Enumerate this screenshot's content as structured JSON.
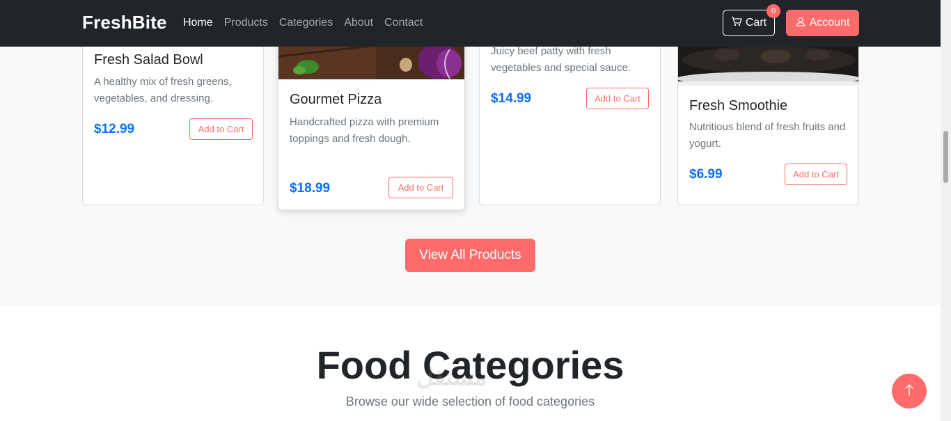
{
  "navbar": {
    "brand": "FreshBite",
    "links": [
      "Home",
      "Products",
      "Categories",
      "About",
      "Contact"
    ],
    "active_link": "Home",
    "cart_label": "Cart",
    "cart_count": "0",
    "account_label": "Account"
  },
  "products": [
    {
      "title": "Fresh Salad Bowl",
      "desc": "A healthy mix of fresh greens, vegetables, and dressing.",
      "price": "$12.99",
      "button": "Add to Cart"
    },
    {
      "title": "Gourmet Pizza",
      "desc": "Handcrafted pizza with premium toppings and fresh dough.",
      "price": "$18.99",
      "button": "Add to Cart"
    },
    {
      "title": "",
      "desc": "Juicy beef patty with fresh vegetables and special sauce.",
      "price": "$14.99",
      "button": "Add to Cart"
    },
    {
      "title": "Fresh Smoothie",
      "desc": "Nutritious blend of fresh fruits and yogurt.",
      "price": "$6.99",
      "button": "Add to Cart"
    }
  ],
  "view_all_label": "View All Products",
  "categories": {
    "title": "Food Categories",
    "subtitle": "Browse our wide selection of food categories"
  },
  "colors": {
    "accent": "#ff6b6b",
    "price": "#0d6efd",
    "navbar": "#212529"
  },
  "icons": {
    "cart": "cart-icon",
    "account": "user-icon",
    "back_to_top": "arrow-up-icon"
  }
}
